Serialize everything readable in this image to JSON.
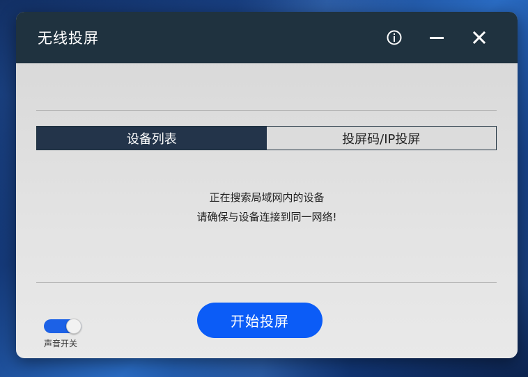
{
  "window": {
    "title": "无线投屏"
  },
  "titlebar": {
    "info_icon": "info-icon",
    "minimize_icon": "minimize-icon",
    "close_icon": "close-icon"
  },
  "tabs": [
    {
      "label": "设备列表",
      "active": true
    },
    {
      "label": "投屏码/IP投屏",
      "active": false
    }
  ],
  "status": {
    "line1": "正在搜索局域网内的设备",
    "line2": "请确保与设备连接到同一网络!"
  },
  "actions": {
    "start_cast_label": "开始投屏"
  },
  "sound": {
    "label": "声音开关",
    "enabled": true
  },
  "colors": {
    "titlebar": "#1f323f",
    "tab_active": "#23344a",
    "primary_button": "#0b5cf7",
    "toggle_on": "#1c61e6"
  }
}
